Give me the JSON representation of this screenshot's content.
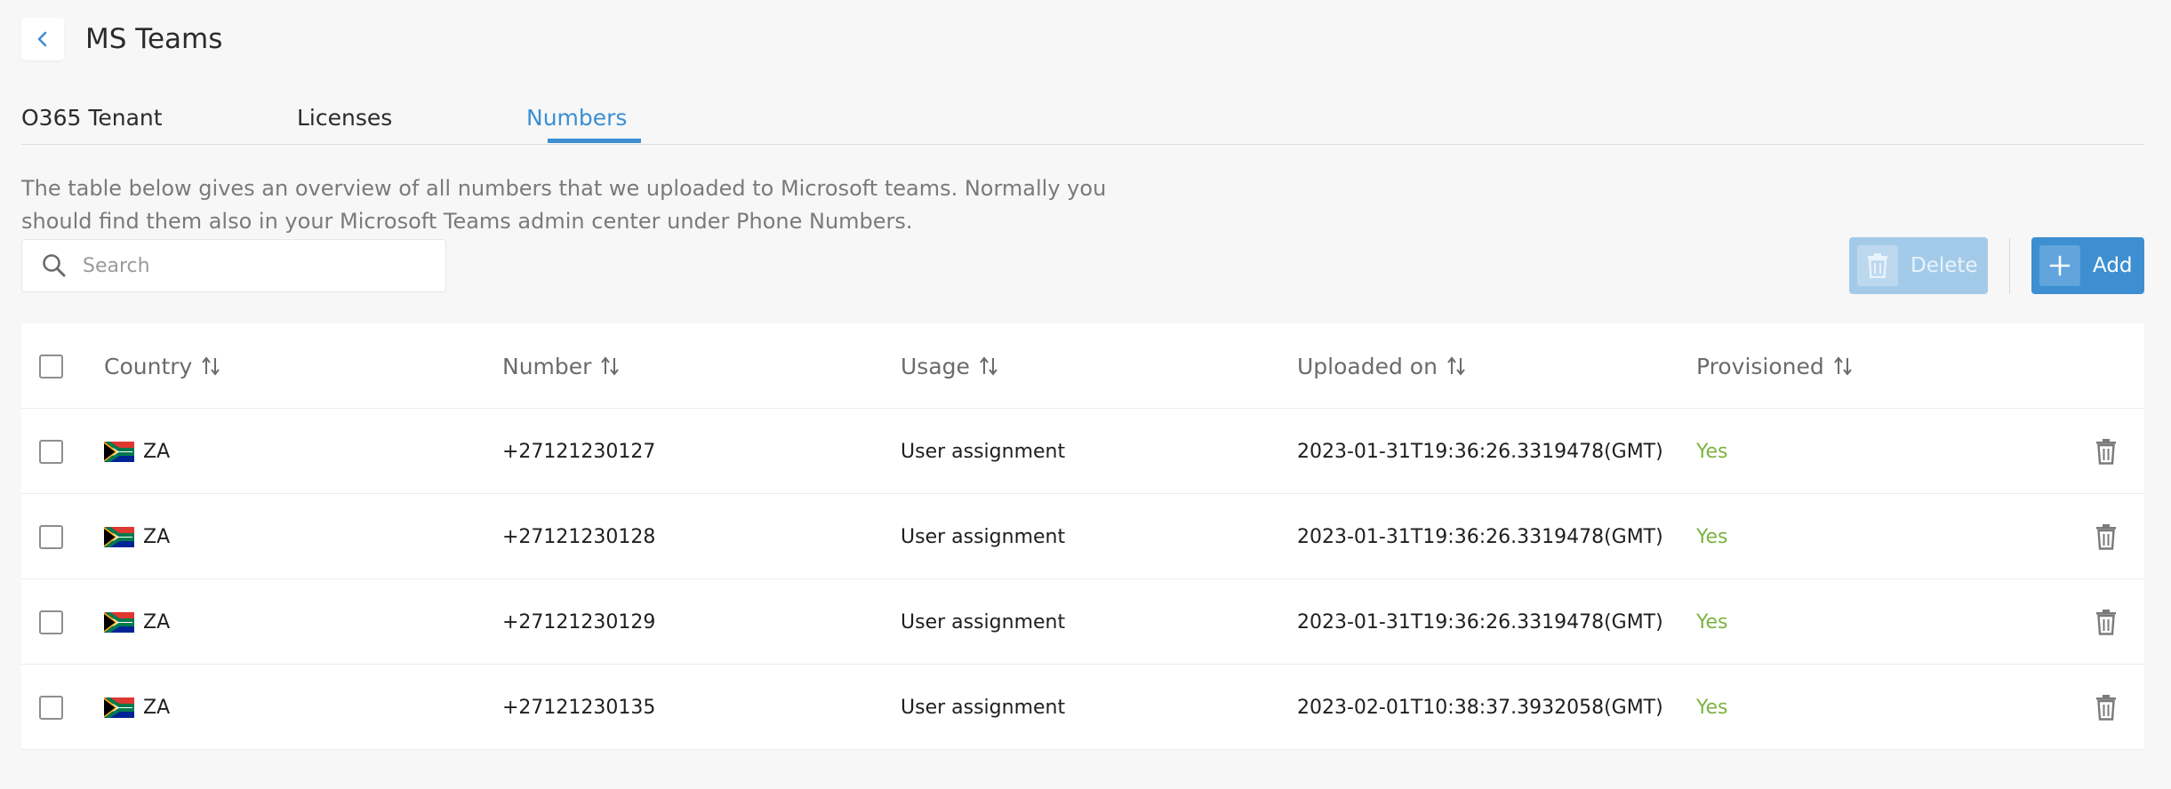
{
  "header": {
    "title": "MS Teams",
    "back_icon": "chevron-left-icon"
  },
  "tabs": [
    {
      "label": "O365 Tenant",
      "active": false
    },
    {
      "label": "Licenses",
      "active": false
    },
    {
      "label": "Numbers",
      "active": true
    }
  ],
  "description": "The table below gives an overview of all numbers that we uploaded to Microsoft teams. Normally you should find them also in your Microsoft Teams admin center under Phone Numbers.",
  "search": {
    "placeholder": "Search",
    "value": ""
  },
  "actions": {
    "delete_label": "Delete",
    "add_label": "Add",
    "delete_enabled": false
  },
  "table": {
    "columns": [
      {
        "key": "country",
        "label": "Country",
        "sortable": true
      },
      {
        "key": "number",
        "label": "Number",
        "sortable": true
      },
      {
        "key": "usage",
        "label": "Usage",
        "sortable": true
      },
      {
        "key": "uploaded_on",
        "label": "Uploaded on",
        "sortable": true
      },
      {
        "key": "provisioned",
        "label": "Provisioned",
        "sortable": true
      }
    ],
    "rows": [
      {
        "country": "ZA",
        "number": "+27121230127",
        "usage": "User assignment",
        "uploaded_on": "2023-01-31T19:36:26.3319478(GMT)",
        "provisioned": "Yes"
      },
      {
        "country": "ZA",
        "number": "+27121230128",
        "usage": "User assignment",
        "uploaded_on": "2023-01-31T19:36:26.3319478(GMT)",
        "provisioned": "Yes"
      },
      {
        "country": "ZA",
        "number": "+27121230129",
        "usage": "User assignment",
        "uploaded_on": "2023-01-31T19:36:26.3319478(GMT)",
        "provisioned": "Yes"
      },
      {
        "country": "ZA",
        "number": "+27121230135",
        "usage": "User assignment",
        "uploaded_on": "2023-02-01T10:38:37.3932058(GMT)",
        "provisioned": "Yes"
      }
    ]
  },
  "colors": {
    "accent": "#3d8fd1",
    "accent_disabled": "#a3cbe9",
    "provisioned_yes": "#7cb342",
    "background": "#f7f7f7"
  }
}
